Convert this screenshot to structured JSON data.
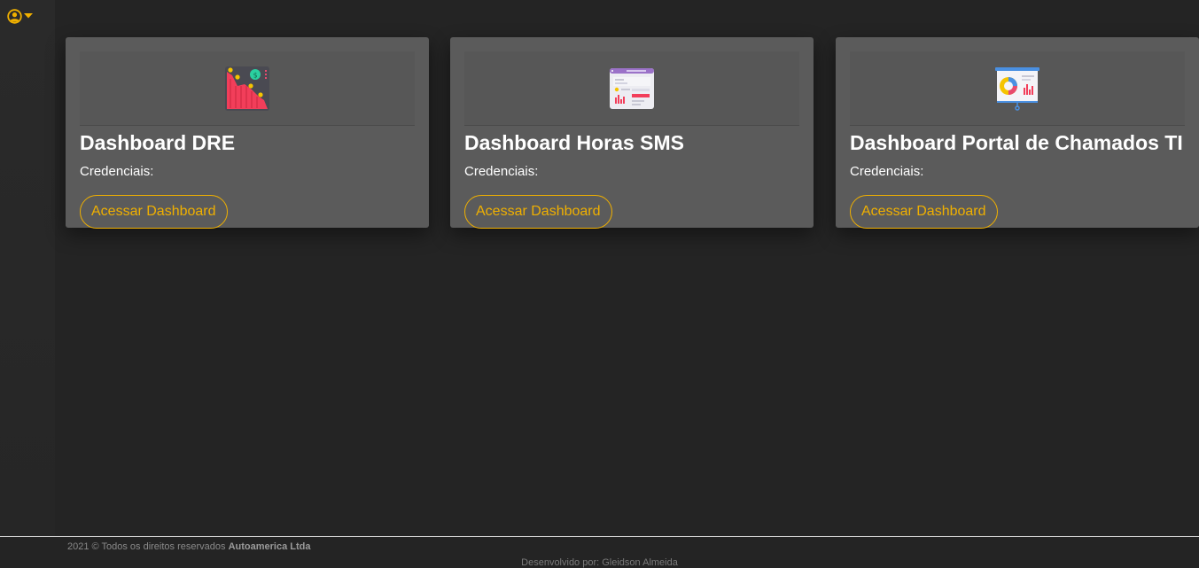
{
  "sidebar": {
    "user_icon": "user-circle-icon",
    "dropdown_icon": "caret-down-icon",
    "accent_color": "#f0b000"
  },
  "cards": [
    {
      "title": "Dashboard DRE",
      "credentials_label": "Credenciais:",
      "button_label": "Acessar Dashboard",
      "icon": "financial-chart-icon"
    },
    {
      "title": "Dashboard Horas SMS",
      "credentials_label": "Credenciais:",
      "button_label": "Acessar Dashboard",
      "icon": "web-report-icon"
    },
    {
      "title": "Dashboard Portal de Chamados TI",
      "credentials_label": "Credenciais:",
      "button_label": "Acessar Dashboard",
      "icon": "presentation-board-icon"
    }
  ],
  "footer": {
    "copyright_prefix": "2021 © Todos os direitos reservados",
    "company": "Autoamerica Ltda",
    "developer": "Desenvolvido por: Gleidson Almeida"
  }
}
